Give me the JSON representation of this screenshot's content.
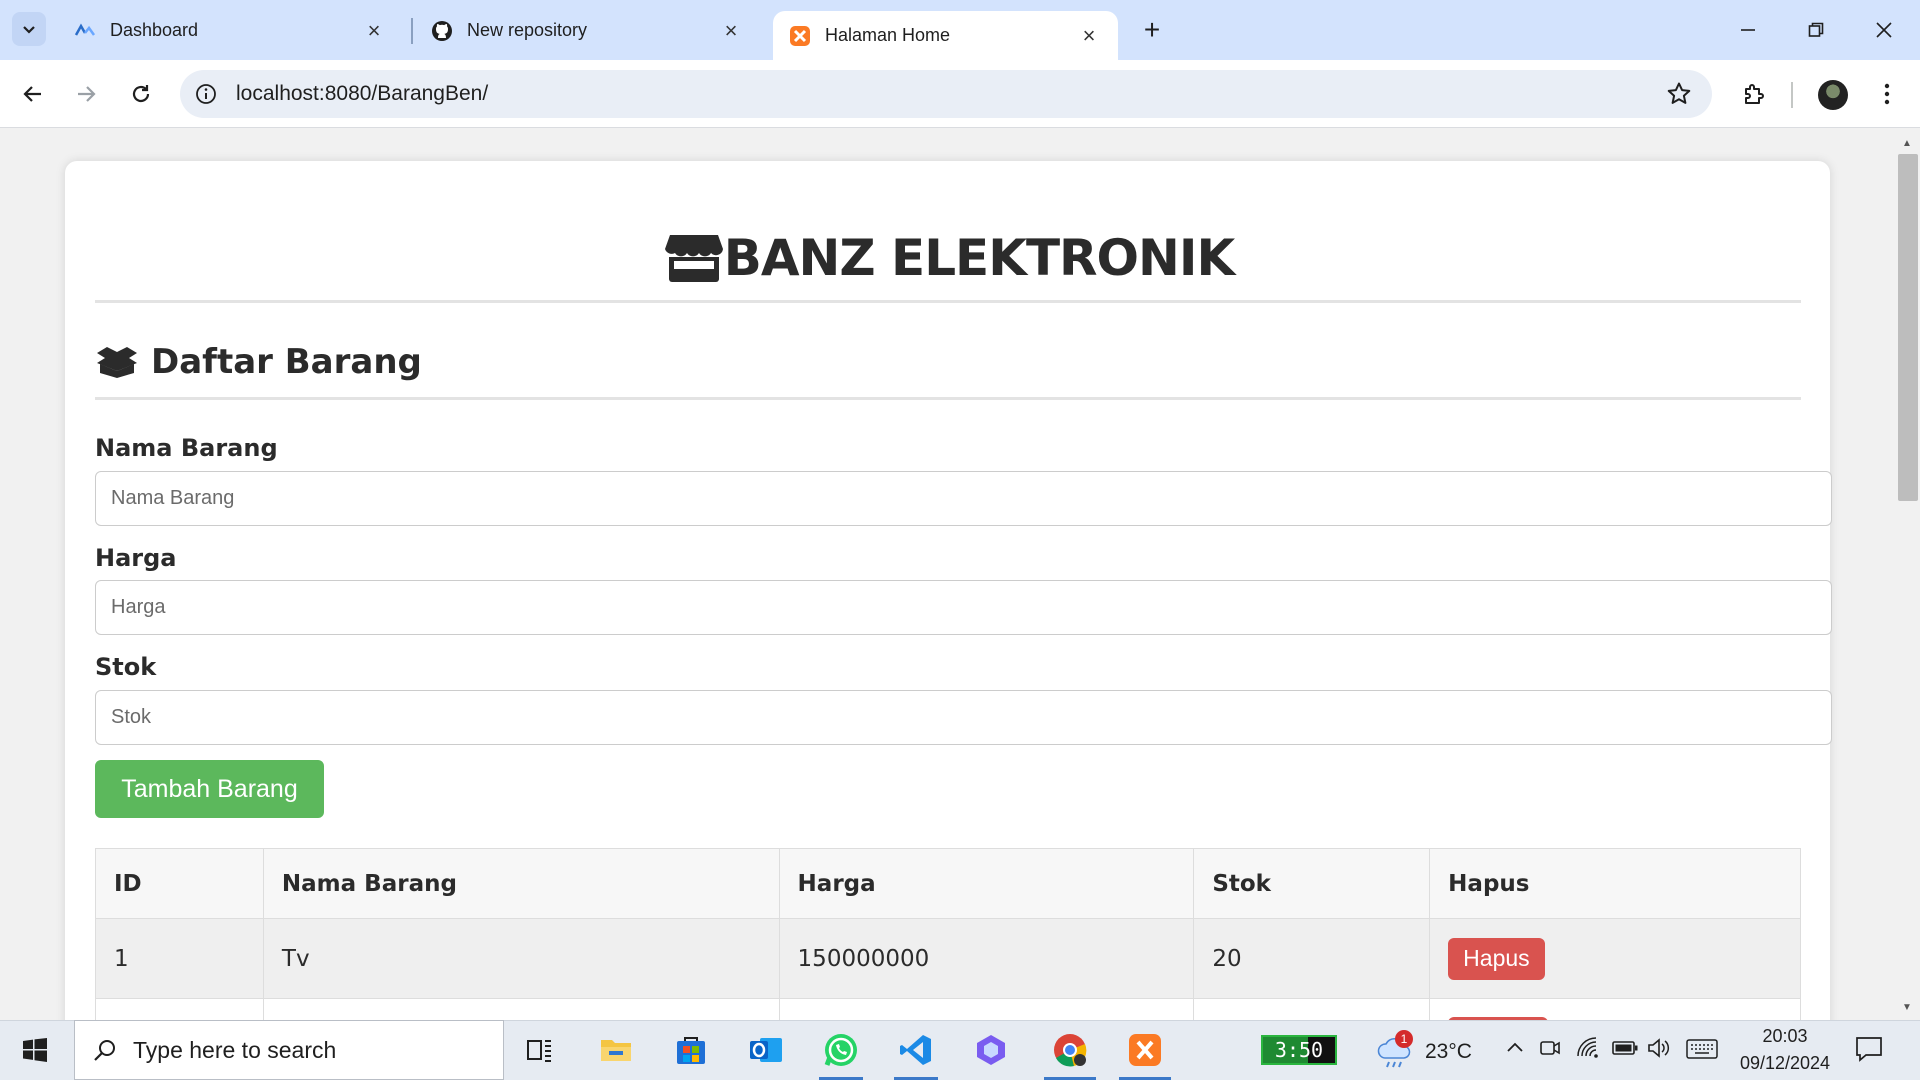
{
  "browser": {
    "tabs": [
      {
        "title": "Dashboard",
        "icon": "dashboard-favicon",
        "active": false
      },
      {
        "title": "New repository",
        "icon": "github-icon",
        "active": false
      },
      {
        "title": "Halaman Home",
        "icon": "xampp-icon",
        "active": true
      }
    ],
    "url": "localhost:8080/BarangBen/"
  },
  "page": {
    "brand": "BANZ ELEKTRONIK",
    "section_title": "Daftar Barang",
    "form": {
      "name_label": "Nama Barang",
      "name_placeholder": "Nama Barang",
      "price_label": "Harga",
      "price_placeholder": "Harga",
      "stock_label": "Stok",
      "stock_placeholder": "Stok",
      "submit_label": "Tambah Barang"
    },
    "table": {
      "headers": [
        "ID",
        "Nama Barang",
        "Harga",
        "Stok",
        "Hapus"
      ],
      "rows": [
        {
          "id": "1",
          "name": "Tv",
          "price": "150000000",
          "stock": "20",
          "action": "Hapus"
        }
      ]
    }
  },
  "taskbar": {
    "search_placeholder": "Type here to search",
    "timer": "3:50",
    "weather_badge": "1",
    "temperature": "23°C",
    "time": "20:03",
    "date": "09/12/2024"
  },
  "colors": {
    "primary_button": "#5cb85c",
    "danger_button": "#d9534f",
    "tab_strip": "#d3e3fd"
  }
}
